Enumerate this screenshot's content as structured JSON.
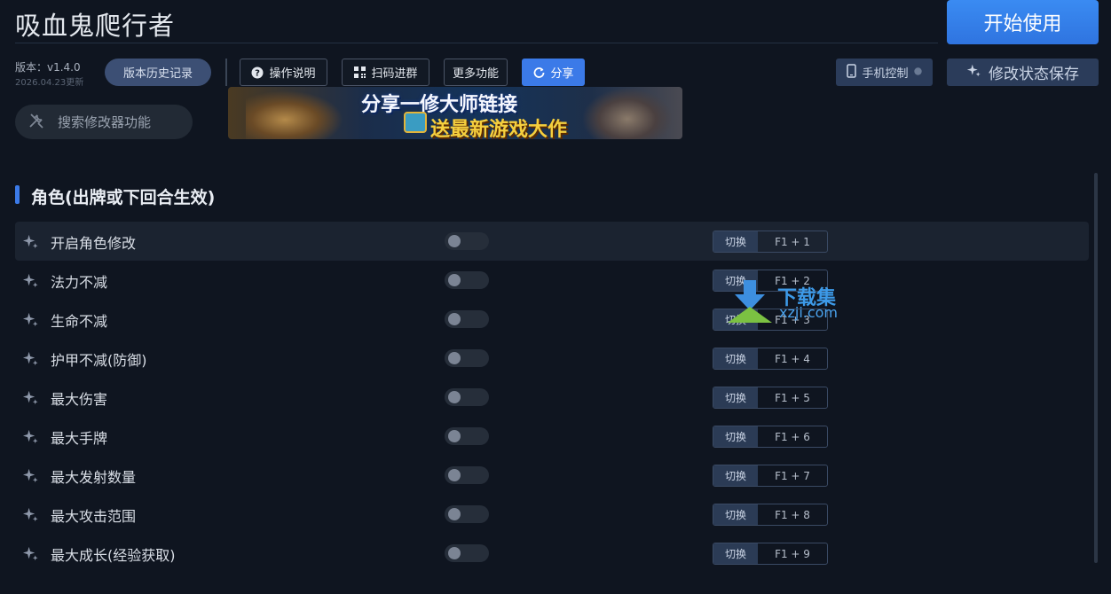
{
  "app": {
    "title": "吸血鬼爬行者",
    "start_label": "开始使用",
    "version": "版本：v1.4.0",
    "version_date": "2026.04.23更新"
  },
  "toolbar": {
    "history_label": "版本历史记录",
    "help_label": "操作说明",
    "qr_label": "扫码进群",
    "more_label": "更多功能",
    "share_label": "分享",
    "phone_label": "手机控制",
    "save_label": "修改状态保存"
  },
  "search": {
    "placeholder": "搜索修改器功能"
  },
  "banner": {
    "line1": "分享一修大师链接",
    "line2": "送最新游戏大作"
  },
  "section": {
    "title": "角色(出牌或下回合生效)",
    "switch_label": "切换",
    "items": [
      {
        "label": "开启角色修改",
        "hotkey": "F1 + 1",
        "on": false,
        "active": true
      },
      {
        "label": "法力不减",
        "hotkey": "F1 + 2",
        "on": false
      },
      {
        "label": "生命不减",
        "hotkey": "F1 + 3",
        "on": false
      },
      {
        "label": "护甲不减(防御)",
        "hotkey": "F1 + 4",
        "on": false
      },
      {
        "label": "最大伤害",
        "hotkey": "F1 + 5",
        "on": false
      },
      {
        "label": "最大手牌",
        "hotkey": "F1 + 6",
        "on": false
      },
      {
        "label": "最大发射数量",
        "hotkey": "F1 + 7",
        "on": false
      },
      {
        "label": "最大攻击范围",
        "hotkey": "F1 + 8",
        "on": false
      },
      {
        "label": "最大成长(经验获取)",
        "hotkey": "F1 + 9",
        "on": false
      }
    ]
  },
  "watermark": {
    "brand": "下载集",
    "domain": "xzji.com"
  },
  "colors": {
    "accent": "#3b7ae8",
    "background": "#0f1520"
  }
}
